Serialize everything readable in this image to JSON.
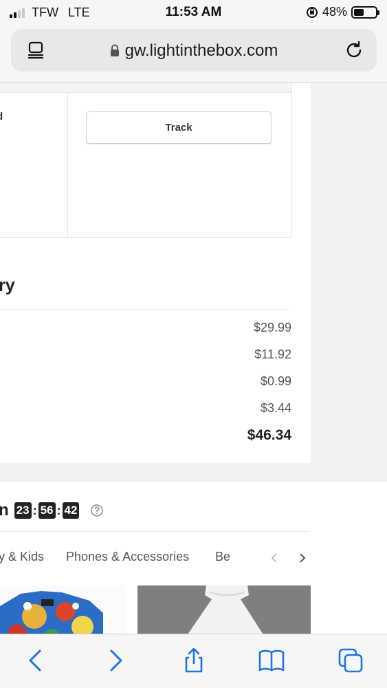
{
  "status_bar": {
    "carrier": "TFW",
    "network": "LTE",
    "time": "11:53 AM",
    "battery": "48%",
    "battery_level": 0.48
  },
  "browser": {
    "url": "gw.lightinthebox.com"
  },
  "order_tracking": {
    "left_cell_fragment": "d",
    "track_button": "Track"
  },
  "order_summary": {
    "title_fragment": "ry",
    "prices": [
      "$29.99",
      "$11.92",
      "$0.99",
      "$3.44"
    ],
    "total": "$46.34"
  },
  "flash_sale": {
    "title_fragment": "n",
    "hours": "23",
    "minutes": "56",
    "seconds": "42",
    "categories": [
      "y & Kids",
      "Phones & Accessories",
      "Be"
    ]
  },
  "colors": {
    "accent": "#1a73e8",
    "text": "#222222",
    "muted": "#555555"
  }
}
